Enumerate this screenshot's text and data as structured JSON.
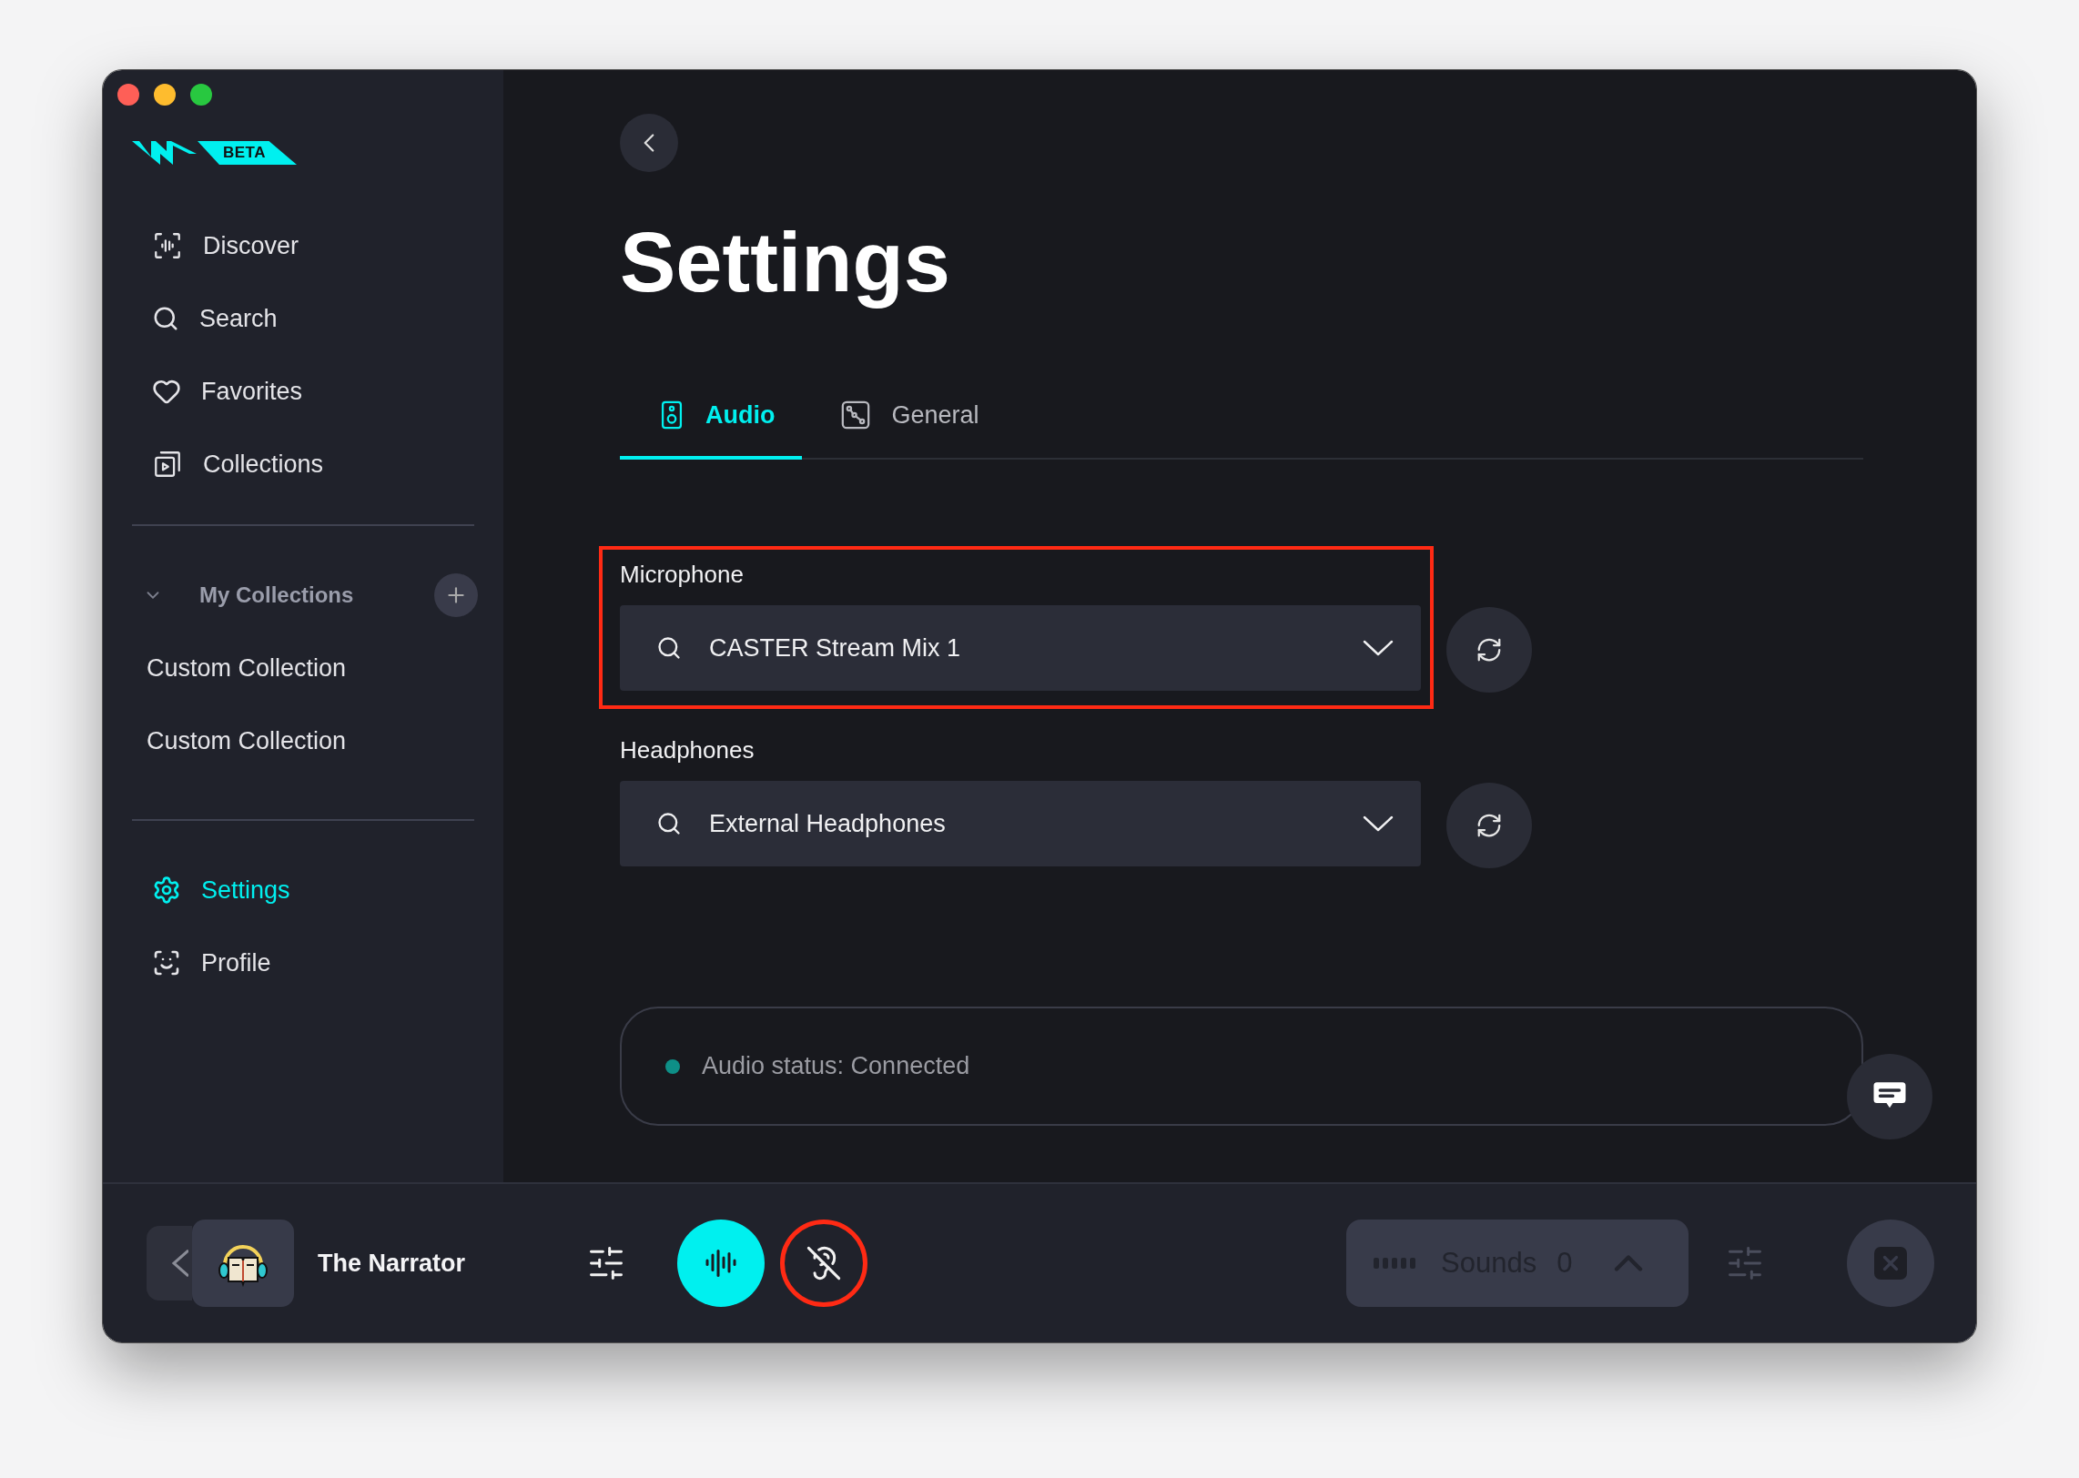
{
  "logo": {
    "badge": "BETA"
  },
  "sidebar": {
    "nav": [
      {
        "label": "Discover",
        "kind": "discover",
        "selected": false
      },
      {
        "label": "Search",
        "kind": "search",
        "selected": false
      },
      {
        "label": "Favorites",
        "kind": "favorites",
        "selected": false
      },
      {
        "label": "Collections",
        "kind": "collections",
        "selected": false
      }
    ],
    "collections": {
      "title": "My Collections",
      "expanded": true,
      "items": [
        "Custom Collection",
        "Custom Collection"
      ]
    },
    "footer_nav": [
      {
        "label": "Settings",
        "kind": "settings",
        "selected": true
      },
      {
        "label": "Profile",
        "kind": "profile",
        "selected": false
      }
    ]
  },
  "page": {
    "title": "Settings"
  },
  "tabs": [
    {
      "label": "Audio",
      "kind": "audio",
      "selected": true
    },
    {
      "label": "General",
      "kind": "general",
      "selected": false
    }
  ],
  "devices": [
    {
      "label": "Microphone",
      "value": "CASTER Stream Mix 1",
      "highlighted": true
    },
    {
      "label": "Headphones",
      "value": "External Headphones",
      "highlighted": false
    }
  ],
  "status": {
    "text": "Audio status: Connected",
    "connected": true
  },
  "player": {
    "voice": "The Narrator",
    "voice_active": true,
    "listen_muted": true,
    "listen_highlighted": true,
    "sounds": {
      "label": "Sounds",
      "count": "0"
    }
  }
}
